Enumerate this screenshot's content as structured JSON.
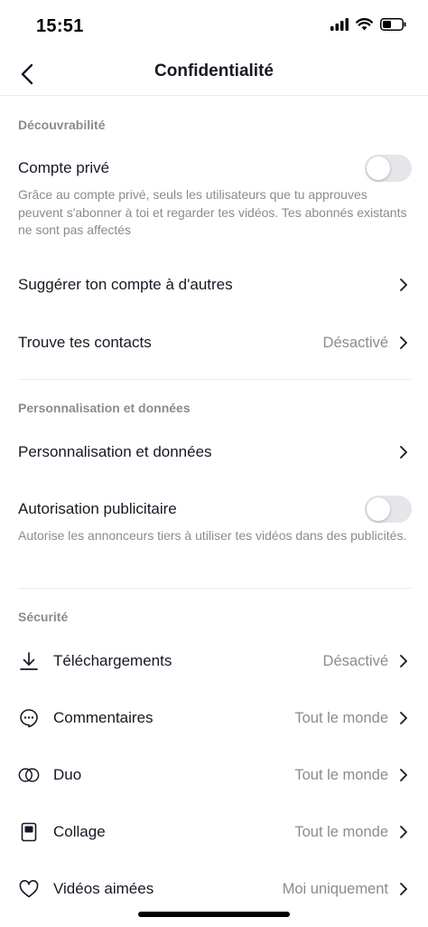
{
  "status_bar": {
    "time": "15:51"
  },
  "header": {
    "title": "Confidentialité"
  },
  "sections": {
    "discoverability": {
      "title": "Découvrabilité",
      "private_account": {
        "label": "Compte privé",
        "enabled": false,
        "description": "Grâce au compte privé, seuls les utilisateurs que tu approuves peuvent s'abonner à toi et regarder tes vidéos. Tes abonnés existants ne sont pas affectés"
      },
      "suggest_account": {
        "label": "Suggérer ton compte à d'autres"
      },
      "find_contacts": {
        "label": "Trouve tes contacts",
        "value": "Désactivé"
      }
    },
    "personalization": {
      "title": "Personnalisation et données",
      "personalization_data": {
        "label": "Personnalisation et données"
      },
      "ad_authorization": {
        "label": "Autorisation publicitaire",
        "enabled": false,
        "description": "Autorise les annonceurs tiers à utiliser tes vidéos dans des publicités."
      }
    },
    "security": {
      "title": "Sécurité",
      "items": [
        {
          "label": "Téléchargements",
          "value": "Désactivé",
          "icon": "download-icon"
        },
        {
          "label": "Commentaires",
          "value": "Tout le monde",
          "icon": "comment-icon"
        },
        {
          "label": "Duo",
          "value": "Tout le monde",
          "icon": "duet-icon"
        },
        {
          "label": "Collage",
          "value": "Tout le monde",
          "icon": "stitch-icon"
        },
        {
          "label": "Vidéos aimées",
          "value": "Moi uniquement",
          "icon": "heart-icon"
        }
      ]
    }
  },
  "colors": {
    "text": "#161823",
    "secondary": "#8a8b91",
    "toggle_off": "#e5e5ea",
    "divider": "#ececec"
  }
}
